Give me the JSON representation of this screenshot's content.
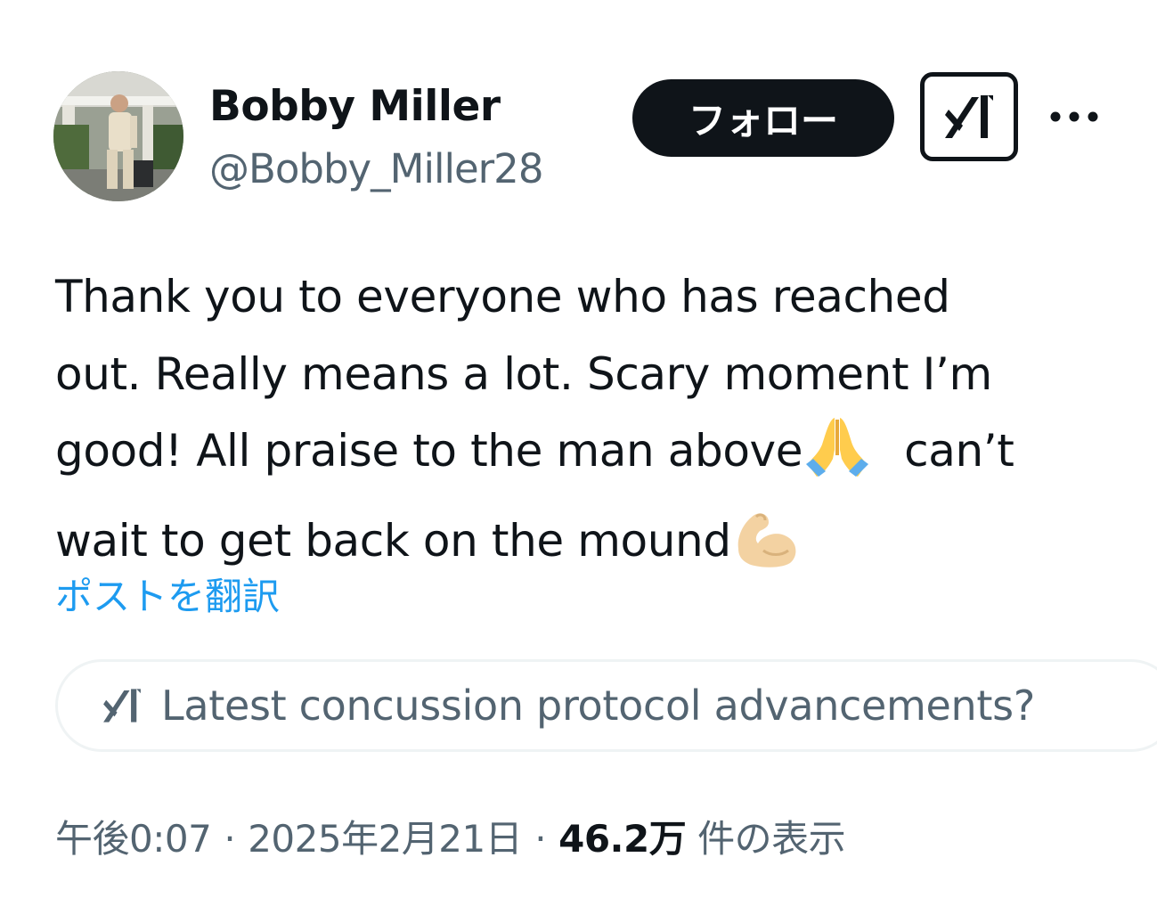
{
  "author": {
    "display_name": "Bobby Miller",
    "handle": "@Bobby_Miller28",
    "avatar_icon": "profile-photo"
  },
  "header_actions": {
    "follow_label": "フォロー",
    "grok_icon": "grok-icon",
    "more_icon": "more-horizontal-icon"
  },
  "tweet": {
    "lines": [
      "Thank you to everyone who has reached",
      "out. Really means a lot. Scary moment I’m",
      "good! All praise to the man above",
      "can’t",
      "wait to get back on the mound"
    ],
    "emojis": [
      "folded-hands-emoji",
      "flexed-biceps-emoji"
    ],
    "translate_label": "ポストを翻訳"
  },
  "grok_prompt": {
    "icon": "grok-icon",
    "text": "Latest concussion protocol advancements?"
  },
  "meta": {
    "time": "午後0:07",
    "separator": "·",
    "date": "2025年2月21日",
    "views_count": "46.2万",
    "views_label": "件の表示"
  },
  "colors": {
    "text_primary": "#0f1419",
    "text_secondary": "#536471",
    "link": "#1d9bf0",
    "button_bg": "#0f1419",
    "border": "#eff3f4"
  }
}
